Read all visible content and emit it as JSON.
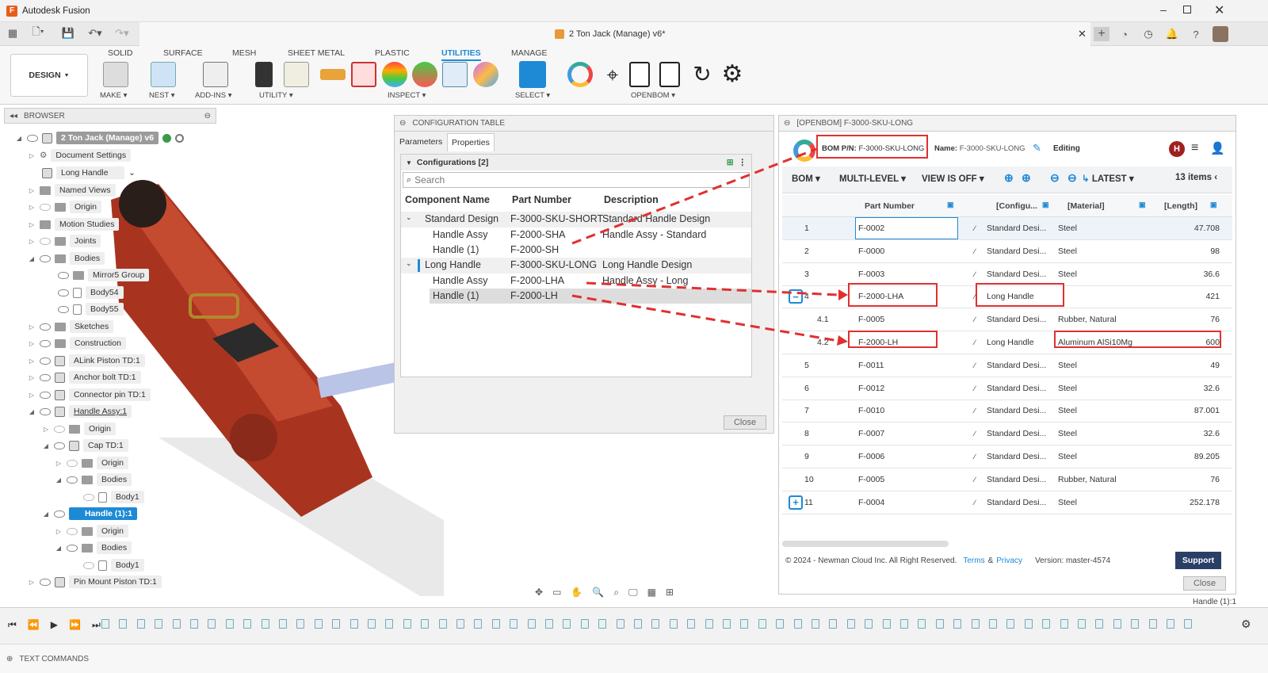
{
  "app": {
    "title": "Autodesk Fusion"
  },
  "document": {
    "tab_title": "2 Ton Jack (Manage) v6*"
  },
  "ribbon": {
    "tabs": [
      "SOLID",
      "SURFACE",
      "MESH",
      "SHEET METAL",
      "PLASTIC",
      "UTILITIES",
      "MANAGE"
    ],
    "active_tab": "UTILITIES",
    "workspace": "DESIGN",
    "groups": [
      "MAKE",
      "NEST",
      "ADD-INS",
      "UTILITY",
      "INSPECT",
      "SELECT",
      "OPENBOM"
    ]
  },
  "browser": {
    "title": "BROWSER",
    "items": [
      {
        "label": "2 Ton Jack (Manage) v6"
      },
      {
        "label": "Document Settings"
      },
      {
        "label": "Long Handle"
      },
      {
        "label": "Named Views"
      },
      {
        "label": "Origin"
      },
      {
        "label": "Motion Studies"
      },
      {
        "label": "Joints"
      },
      {
        "label": "Bodies"
      },
      {
        "label": "Mirror5 Group"
      },
      {
        "label": "Body54"
      },
      {
        "label": "Body55"
      },
      {
        "label": "Sketches"
      },
      {
        "label": "Construction"
      },
      {
        "label": "ALink Piston TD:1"
      },
      {
        "label": "Anchor bolt TD:1"
      },
      {
        "label": "Connector pin TD:1"
      },
      {
        "label": "Handle Assy:1"
      },
      {
        "label": "Origin"
      },
      {
        "label": "Cap TD:1"
      },
      {
        "label": "Origin"
      },
      {
        "label": "Bodies"
      },
      {
        "label": "Body1"
      },
      {
        "label": "Handle (1):1"
      },
      {
        "label": "Origin"
      },
      {
        "label": "Bodies"
      },
      {
        "label": "Body1"
      },
      {
        "label": "Pin Mount Piston TD:1"
      }
    ]
  },
  "config_table": {
    "title": "CONFIGURATION TABLE",
    "tabs": [
      "Parameters",
      "Properties"
    ],
    "active_tab": "Properties",
    "section": "Configurations [2]",
    "search_placeholder": "Search",
    "columns": [
      "Component Name",
      "Part Number",
      "Description"
    ],
    "rows": [
      {
        "name": "Standard Design",
        "part": "F-3000-SKU-SHORT",
        "desc": "Standard Handle Design"
      },
      {
        "name": "Handle Assy",
        "part": "F-2000-SHA",
        "desc": "Handle Assy - Standard"
      },
      {
        "name": "Handle (1)",
        "part": "F-2000-SH",
        "desc": ""
      },
      {
        "name": "Long Handle",
        "part": "F-3000-SKU-LONG",
        "desc": "Long Handle Design"
      },
      {
        "name": "Handle Assy",
        "part": "F-2000-LHA",
        "desc": "Handle Assy - Long"
      },
      {
        "name": "Handle (1)",
        "part": "F-2000-LH",
        "desc": ""
      }
    ],
    "close_label": "Close"
  },
  "openbom": {
    "title": "[OPENBOM] F-3000-SKU-LONG",
    "bom_pn_label": "BOM P/N:",
    "bom_pn": "F-3000-SKU-LONG",
    "name_label": "Name:",
    "name": "F-3000-SKU-LONG",
    "status": "Editing",
    "avatar": "H",
    "toolbar": {
      "bom": "BOM",
      "multilevel": "MULTI-LEVEL",
      "view": "VIEW IS OFF",
      "latest": "LATEST",
      "count": "13 items"
    },
    "columns": [
      "Part Number",
      "[Configu...",
      "[Material]",
      "[Length]"
    ],
    "rows": [
      {
        "num": "1",
        "part": "F-0002",
        "config": "Standard Desi...",
        "material": "Steel",
        "length": "47.708"
      },
      {
        "num": "2",
        "part": "F-0000",
        "config": "Standard Desi...",
        "material": "Steel",
        "length": "98"
      },
      {
        "num": "3",
        "part": "F-0003",
        "config": "Standard Desi...",
        "material": "Steel",
        "length": "36.6"
      },
      {
        "num": "4",
        "part": "F-2000-LHA",
        "config": "Long Handle",
        "material": "",
        "length": "421"
      },
      {
        "num": "4.1",
        "part": "F-0005",
        "config": "Standard Desi...",
        "material": "Rubber, Natural",
        "length": "76"
      },
      {
        "num": "4.2",
        "part": "F-2000-LH",
        "config": "Long Handle",
        "material": "Aluminum AlSi10Mg",
        "length": "600"
      },
      {
        "num": "5",
        "part": "F-0011",
        "config": "Standard Desi...",
        "material": "Steel",
        "length": "49"
      },
      {
        "num": "6",
        "part": "F-0012",
        "config": "Standard Desi...",
        "material": "Steel",
        "length": "32.6"
      },
      {
        "num": "7",
        "part": "F-0010",
        "config": "Standard Desi...",
        "material": "Steel",
        "length": "87.001"
      },
      {
        "num": "8",
        "part": "F-0007",
        "config": "Standard Desi...",
        "material": "Steel",
        "length": "32.6"
      },
      {
        "num": "9",
        "part": "F-0006",
        "config": "Standard Desi...",
        "material": "Steel",
        "length": "89.205"
      },
      {
        "num": "10",
        "part": "F-0005",
        "config": "Standard Desi...",
        "material": "Rubber, Natural",
        "length": "76"
      },
      {
        "num": "11",
        "part": "F-0004",
        "config": "Standard Desi...",
        "material": "Steel",
        "length": "252.178"
      }
    ],
    "footer": {
      "copyright": "© 2024 - Newman Cloud Inc. All Right Reserved.",
      "terms": "Terms",
      "amp": "&",
      "privacy": "Privacy",
      "version": "Version: master-4574",
      "support": "Support"
    },
    "close_label": "Close",
    "status_right": "Handle (1):1"
  },
  "footer": {
    "text_commands": "TEXT COMMANDS"
  },
  "colors": {
    "accent": "#1e8ad6",
    "highlight": "#e03030",
    "jack_red": "#b5301f",
    "support_btn": "#2a3f66"
  }
}
